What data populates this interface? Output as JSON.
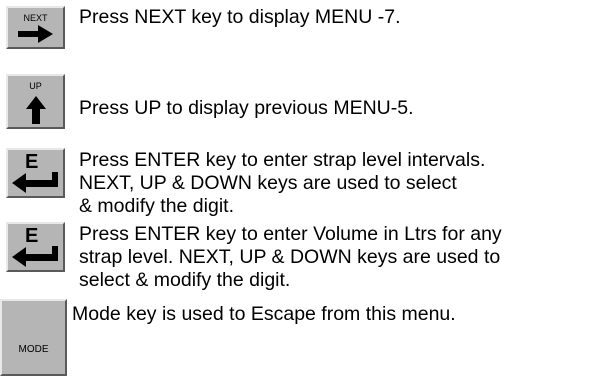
{
  "instructions": {
    "next": {
      "key_label": "NEXT",
      "icon": "right-arrow-icon",
      "text": "Press NEXT key to display MENU -7."
    },
    "up": {
      "key_label": "UP",
      "icon": "up-arrow-icon",
      "text": "Press UP to display previous MENU-5."
    },
    "enter_strap": {
      "key_label": "E",
      "icon": "enter-arrow-icon",
      "lines": [
        "Press ENTER key to enter strap level intervals.",
        "NEXT, UP & DOWN keys are used to select",
        "& modify the digit."
      ]
    },
    "enter_volume": {
      "key_label": "E",
      "icon": "enter-arrow-icon",
      "lines": [
        "Press ENTER key to enter Volume in Ltrs for any",
        "strap level. NEXT, UP & DOWN keys are used to",
        "select & modify the digit."
      ]
    },
    "mode": {
      "key_label": "MODE",
      "text": "Mode key is used to Escape from this menu."
    }
  },
  "colors": {
    "key_face": "#b5b5b5",
    "key_highlight": "#e8e8e8",
    "key_shadow": "#5a5a5a",
    "text": "#000000"
  }
}
